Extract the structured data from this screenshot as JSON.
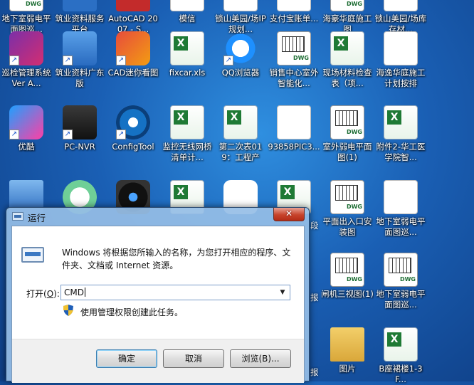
{
  "desktop": {
    "icons": [
      {
        "label": "地下室弱电平面图巡...",
        "type": "dwg"
      },
      {
        "label": "筑业资料服务平台",
        "type": "app-blue"
      },
      {
        "label": "AutoCAD 2007 - S...",
        "type": "app-red"
      },
      {
        "label": "模信",
        "type": "doc"
      },
      {
        "label": "锁山美园/场IP规划...",
        "type": "doc"
      },
      {
        "label": "支付宝账单...",
        "type": "doc"
      },
      {
        "label": "海豪华庭施工图",
        "type": "dwg"
      },
      {
        "label": "锁山美园/场库存材...",
        "type": "doc"
      },
      {
        "label": "巡检管理系统 Ver A...",
        "type": "app-shield"
      },
      {
        "label": "筑业资料广东版",
        "type": "app-house"
      },
      {
        "label": "CAD迷你看图",
        "type": "app-cad"
      },
      {
        "label": "fixcar.xls",
        "type": "xls"
      },
      {
        "label": "QQ浏览器",
        "type": "app-qq"
      },
      {
        "label": "销售中心室外智能化...",
        "type": "dwg"
      },
      {
        "label": "现场材料检查表（项...",
        "type": "xls"
      },
      {
        "label": "海逸华庭施工计划按排",
        "type": "doc"
      },
      {
        "label": "优酷",
        "type": "app-youku"
      },
      {
        "label": "PC-NVR",
        "type": "app-nvr"
      },
      {
        "label": "ConfigTool",
        "type": "app-config"
      },
      {
        "label": "监控无线网桥清单计...",
        "type": "xls"
      },
      {
        "label": "第二次表019：工程产值...",
        "type": "xls"
      },
      {
        "label": "93858PIC3...",
        "type": "doc"
      },
      {
        "label": "室外弱电平面图(1)",
        "type": "dwg"
      },
      {
        "label": "附件2-华工医学院智...",
        "type": "xls"
      },
      {
        "label": "",
        "type": "app-pc"
      },
      {
        "label": "",
        "type": "app-ev"
      },
      {
        "label": "",
        "type": "app-cam"
      },
      {
        "label": "",
        "type": "xls"
      },
      {
        "label": "",
        "type": "app-cloud"
      },
      {
        "label": "",
        "type": "xls"
      },
      {
        "label": "平面出入口安装图",
        "type": "dwg"
      },
      {
        "label": "地下室弱电平面图巡...",
        "type": "doc"
      },
      {
        "label": "闸机三视图(1)",
        "type": "dwg"
      },
      {
        "label": "地下室弱电平面图巡...",
        "type": "dwg"
      },
      {
        "label": "图片",
        "type": "folder"
      },
      {
        "label": "B座裙楼1-3F...",
        "type": "xls"
      }
    ],
    "partial_labels": [
      "段",
      "报",
      "报"
    ]
  },
  "run_dialog": {
    "title": "运行",
    "close_glyph": "✕",
    "description": "Windows 将根据您所输入的名称，为您打开相应的程序、文件夹、文档或 Internet 资源。",
    "open_label_prefix": "打开(",
    "open_label_key": "O",
    "open_label_suffix": "):",
    "input_value": "CMD",
    "dropdown_glyph": "▼",
    "admin_note": "使用管理权限创建此任务。",
    "buttons": {
      "ok": "确定",
      "cancel": "取消",
      "browse": "浏览(B)..."
    }
  }
}
